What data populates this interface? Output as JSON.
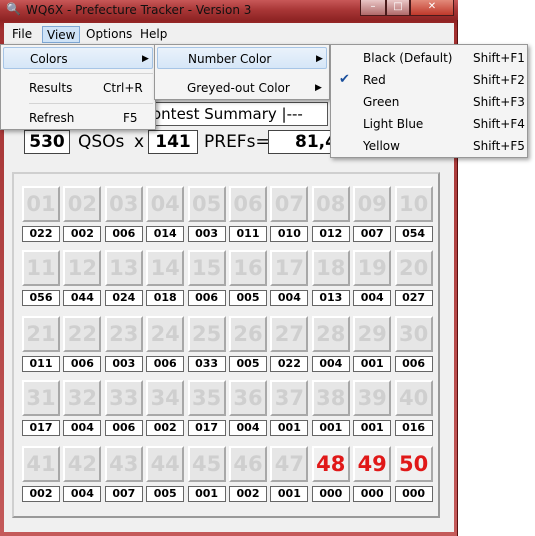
{
  "window": {
    "title": "WQ6X - Prefecture Tracker - Version 3"
  },
  "titlebar_buttons": {
    "minimize": "–",
    "maximize": "□",
    "close": "✕"
  },
  "menubar": [
    "File",
    "View",
    "Options",
    "Help"
  ],
  "view_menu": [
    {
      "label": "Colors",
      "shortcut": "",
      "submenu": true
    },
    {
      "label": "Results",
      "shortcut": "Ctrl+R",
      "submenu": false
    },
    {
      "label": "Refresh",
      "shortcut": "F5",
      "submenu": false
    }
  ],
  "colors_submenu": [
    {
      "label": "Number Color",
      "submenu": true
    },
    {
      "label": "Greyed-out Color",
      "submenu": true
    }
  ],
  "number_color_menu": [
    {
      "label": "Black (Default)",
      "shortcut": "Shift+F1",
      "checked": false
    },
    {
      "label": "Red",
      "shortcut": "Shift+F2",
      "checked": true
    },
    {
      "label": "Green",
      "shortcut": "Shift+F3",
      "checked": false
    },
    {
      "label": "Light Blue",
      "shortcut": "Shift+F4",
      "checked": false
    },
    {
      "label": "Yellow",
      "shortcut": "Shift+F5",
      "checked": false
    }
  ],
  "summary": {
    "title": "ontest Summary |---",
    "qsos_value": "530",
    "qsos_label": "QSOs",
    "times": "x",
    "prefs_value": "141",
    "prefs_label": "PREFs=",
    "score_value": "81,4"
  },
  "prefectures": [
    {
      "num": "01",
      "count": "022",
      "worked": false
    },
    {
      "num": "02",
      "count": "002",
      "worked": false
    },
    {
      "num": "03",
      "count": "006",
      "worked": false
    },
    {
      "num": "04",
      "count": "014",
      "worked": false
    },
    {
      "num": "05",
      "count": "003",
      "worked": false
    },
    {
      "num": "06",
      "count": "011",
      "worked": false
    },
    {
      "num": "07",
      "count": "010",
      "worked": false
    },
    {
      "num": "08",
      "count": "012",
      "worked": false
    },
    {
      "num": "09",
      "count": "007",
      "worked": false
    },
    {
      "num": "10",
      "count": "054",
      "worked": false
    },
    {
      "num": "11",
      "count": "056",
      "worked": false
    },
    {
      "num": "12",
      "count": "044",
      "worked": false
    },
    {
      "num": "13",
      "count": "024",
      "worked": false
    },
    {
      "num": "14",
      "count": "018",
      "worked": false
    },
    {
      "num": "15",
      "count": "006",
      "worked": false
    },
    {
      "num": "16",
      "count": "005",
      "worked": false
    },
    {
      "num": "17",
      "count": "004",
      "worked": false
    },
    {
      "num": "18",
      "count": "013",
      "worked": false
    },
    {
      "num": "19",
      "count": "004",
      "worked": false
    },
    {
      "num": "20",
      "count": "027",
      "worked": false
    },
    {
      "num": "21",
      "count": "011",
      "worked": false
    },
    {
      "num": "22",
      "count": "006",
      "worked": false
    },
    {
      "num": "23",
      "count": "003",
      "worked": false
    },
    {
      "num": "24",
      "count": "006",
      "worked": false
    },
    {
      "num": "25",
      "count": "033",
      "worked": false
    },
    {
      "num": "26",
      "count": "005",
      "worked": false
    },
    {
      "num": "27",
      "count": "022",
      "worked": false
    },
    {
      "num": "28",
      "count": "004",
      "worked": false
    },
    {
      "num": "29",
      "count": "001",
      "worked": false
    },
    {
      "num": "30",
      "count": "006",
      "worked": false
    },
    {
      "num": "31",
      "count": "017",
      "worked": false
    },
    {
      "num": "32",
      "count": "004",
      "worked": false
    },
    {
      "num": "33",
      "count": "006",
      "worked": false
    },
    {
      "num": "34",
      "count": "002",
      "worked": false
    },
    {
      "num": "35",
      "count": "017",
      "worked": false
    },
    {
      "num": "36",
      "count": "004",
      "worked": false
    },
    {
      "num": "37",
      "count": "001",
      "worked": false
    },
    {
      "num": "38",
      "count": "001",
      "worked": false
    },
    {
      "num": "39",
      "count": "001",
      "worked": false
    },
    {
      "num": "40",
      "count": "016",
      "worked": false
    },
    {
      "num": "41",
      "count": "002",
      "worked": false
    },
    {
      "num": "42",
      "count": "004",
      "worked": false
    },
    {
      "num": "43",
      "count": "007",
      "worked": false
    },
    {
      "num": "44",
      "count": "005",
      "worked": false
    },
    {
      "num": "45",
      "count": "001",
      "worked": false
    },
    {
      "num": "46",
      "count": "002",
      "worked": false
    },
    {
      "num": "47",
      "count": "001",
      "worked": false
    },
    {
      "num": "48",
      "count": "000",
      "worked": true
    },
    {
      "num": "49",
      "count": "000",
      "worked": true
    },
    {
      "num": "50",
      "count": "000",
      "worked": true
    }
  ],
  "colors": {
    "number_red": "#e01818",
    "greyed": "#cfcfcf",
    "menu_highlight": "#d6e6f7"
  }
}
